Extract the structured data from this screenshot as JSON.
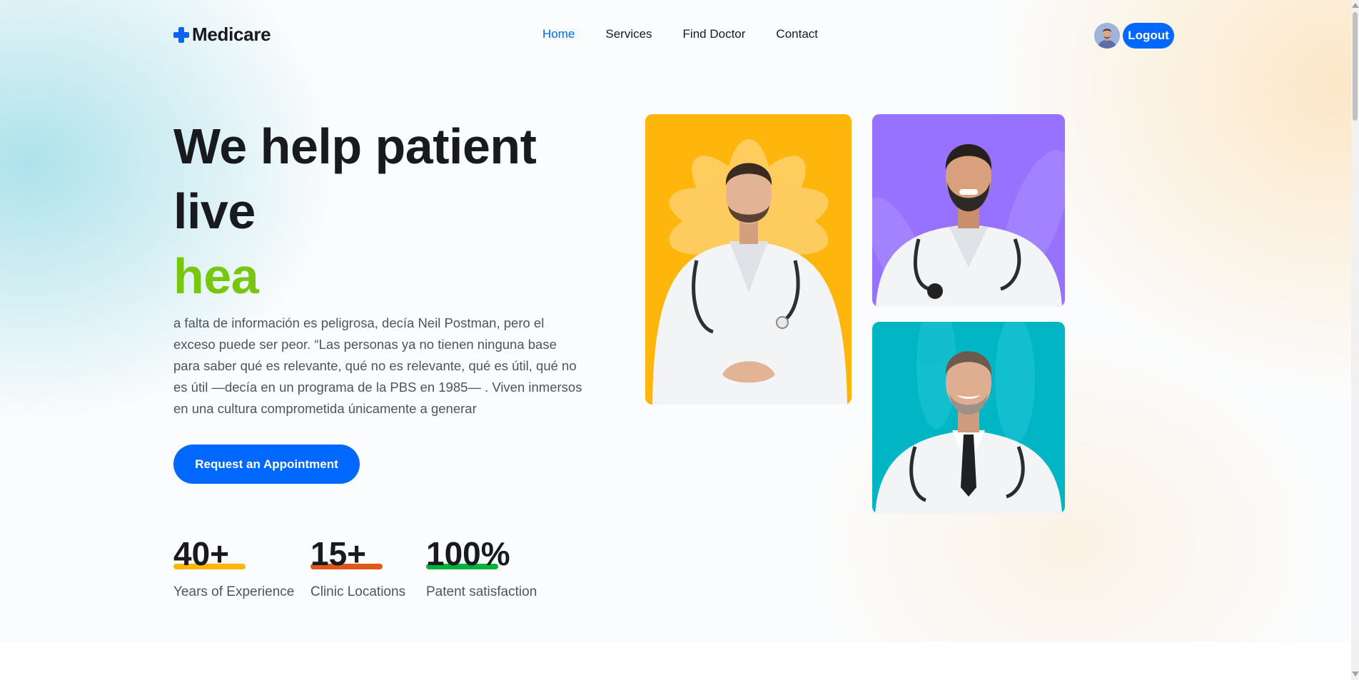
{
  "app": {
    "logo_text": "Medicare",
    "logo_icon": "medical-cross-icon",
    "accent_color": "#0067FF"
  },
  "nav": {
    "items": [
      {
        "label": "Home",
        "active": true
      },
      {
        "label": "Services",
        "active": false
      },
      {
        "label": "Find Doctor",
        "active": false
      },
      {
        "label": "Contact",
        "active": false
      }
    ]
  },
  "user": {
    "avatar_icon": "user-avatar",
    "logout_label": "Logout"
  },
  "hero": {
    "headline_line1": "We help patient",
    "headline_line2": "live",
    "headline_accent": "hea",
    "accent_color": "#79C60E",
    "intro": "a falta de información es peligrosa, decía Neil Postman, pero el exceso puede ser peor. “Las personas ya no tienen ninguna base para saber qué es relevante, qué no es relevante, qué es útil, qué no es útil —decía en un programa de la PBS en 1985— . Viven inmersos en una cultura comprometida únicamente a generar",
    "cta_label": "Request an Appointment"
  },
  "stats": [
    {
      "value": "40+",
      "label": "Years of Experience",
      "bar_color": "#FEB60D"
    },
    {
      "value": "15+",
      "label": "Clinic Locations",
      "bar_color": "#E0591A"
    },
    {
      "value": "100%",
      "label": "Patent satisfaction",
      "bar_color": "#01B53A"
    }
  ],
  "doctor_cards": [
    {
      "image": "doctor-photo",
      "background": "#FEB60D"
    },
    {
      "image": "doctor-photo",
      "background": "#9771FF"
    },
    {
      "image": "doctor-photo",
      "background": "#01B5C5"
    }
  ]
}
